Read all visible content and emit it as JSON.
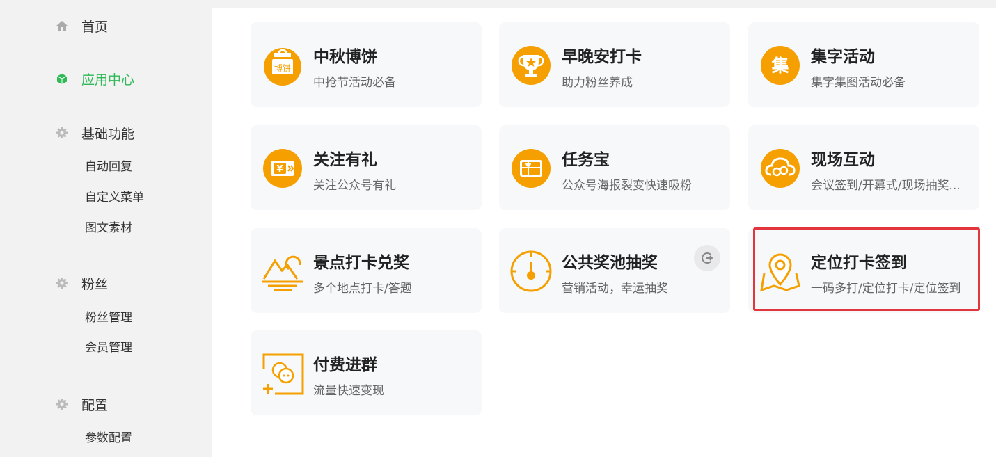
{
  "sidebar": {
    "home": {
      "label": "首页",
      "icon": "home-icon"
    },
    "app_center": {
      "label": "应用中心",
      "icon": "cube-icon"
    },
    "basic": {
      "label": "基础功能",
      "icon": "gear-icon",
      "items": [
        "自动回复",
        "自定义菜单",
        "图文素材"
      ]
    },
    "fans": {
      "label": "粉丝",
      "icon": "gear-icon",
      "items": [
        "粉丝管理",
        "会员管理"
      ]
    },
    "config": {
      "label": "配置",
      "icon": "gear-icon",
      "items": [
        "参数配置"
      ]
    }
  },
  "cards": [
    {
      "title": "中秋博饼",
      "desc": "中抢节活动必备",
      "icon": "mooncake-dice-icon",
      "icon_text": "博饼"
    },
    {
      "title": "早晚安打卡",
      "desc": "助力粉丝养成",
      "icon": "trophy-icon"
    },
    {
      "title": "集字活动",
      "desc": "集字集图活动必备",
      "icon": "collect-character-icon",
      "icon_text": "集"
    },
    {
      "title": "关注有礼",
      "desc": "关注公众号有礼",
      "icon": "gift-card-icon",
      "icon_text": "¥"
    },
    {
      "title": "任务宝",
      "desc": "公众号海报裂变快速吸粉",
      "icon": "gift-box-icon"
    },
    {
      "title": "现场互动",
      "desc": "会议签到/开幕式/现场抽奖...",
      "icon": "cloud-link-icon"
    },
    {
      "title": "景点打卡兑奖",
      "desc": "多个地点打卡/答题",
      "icon": "mountain-sun-icon"
    },
    {
      "title": "公共奖池抽奖",
      "desc": "营销活动，幸运抽奖",
      "icon": "lottery-dial-icon",
      "badge_icon": "exit-icon"
    },
    {
      "title": "定位打卡签到",
      "desc": "一码多打/定位打卡/定位签到",
      "icon": "location-map-icon"
    },
    {
      "title": "付费进群",
      "desc": "流量快速变现",
      "icon": "paid-group-chat-icon"
    }
  ],
  "colors": {
    "accent_orange": "#f5a000",
    "active_green": "#2fba57",
    "highlight_red": "#e2363e"
  }
}
